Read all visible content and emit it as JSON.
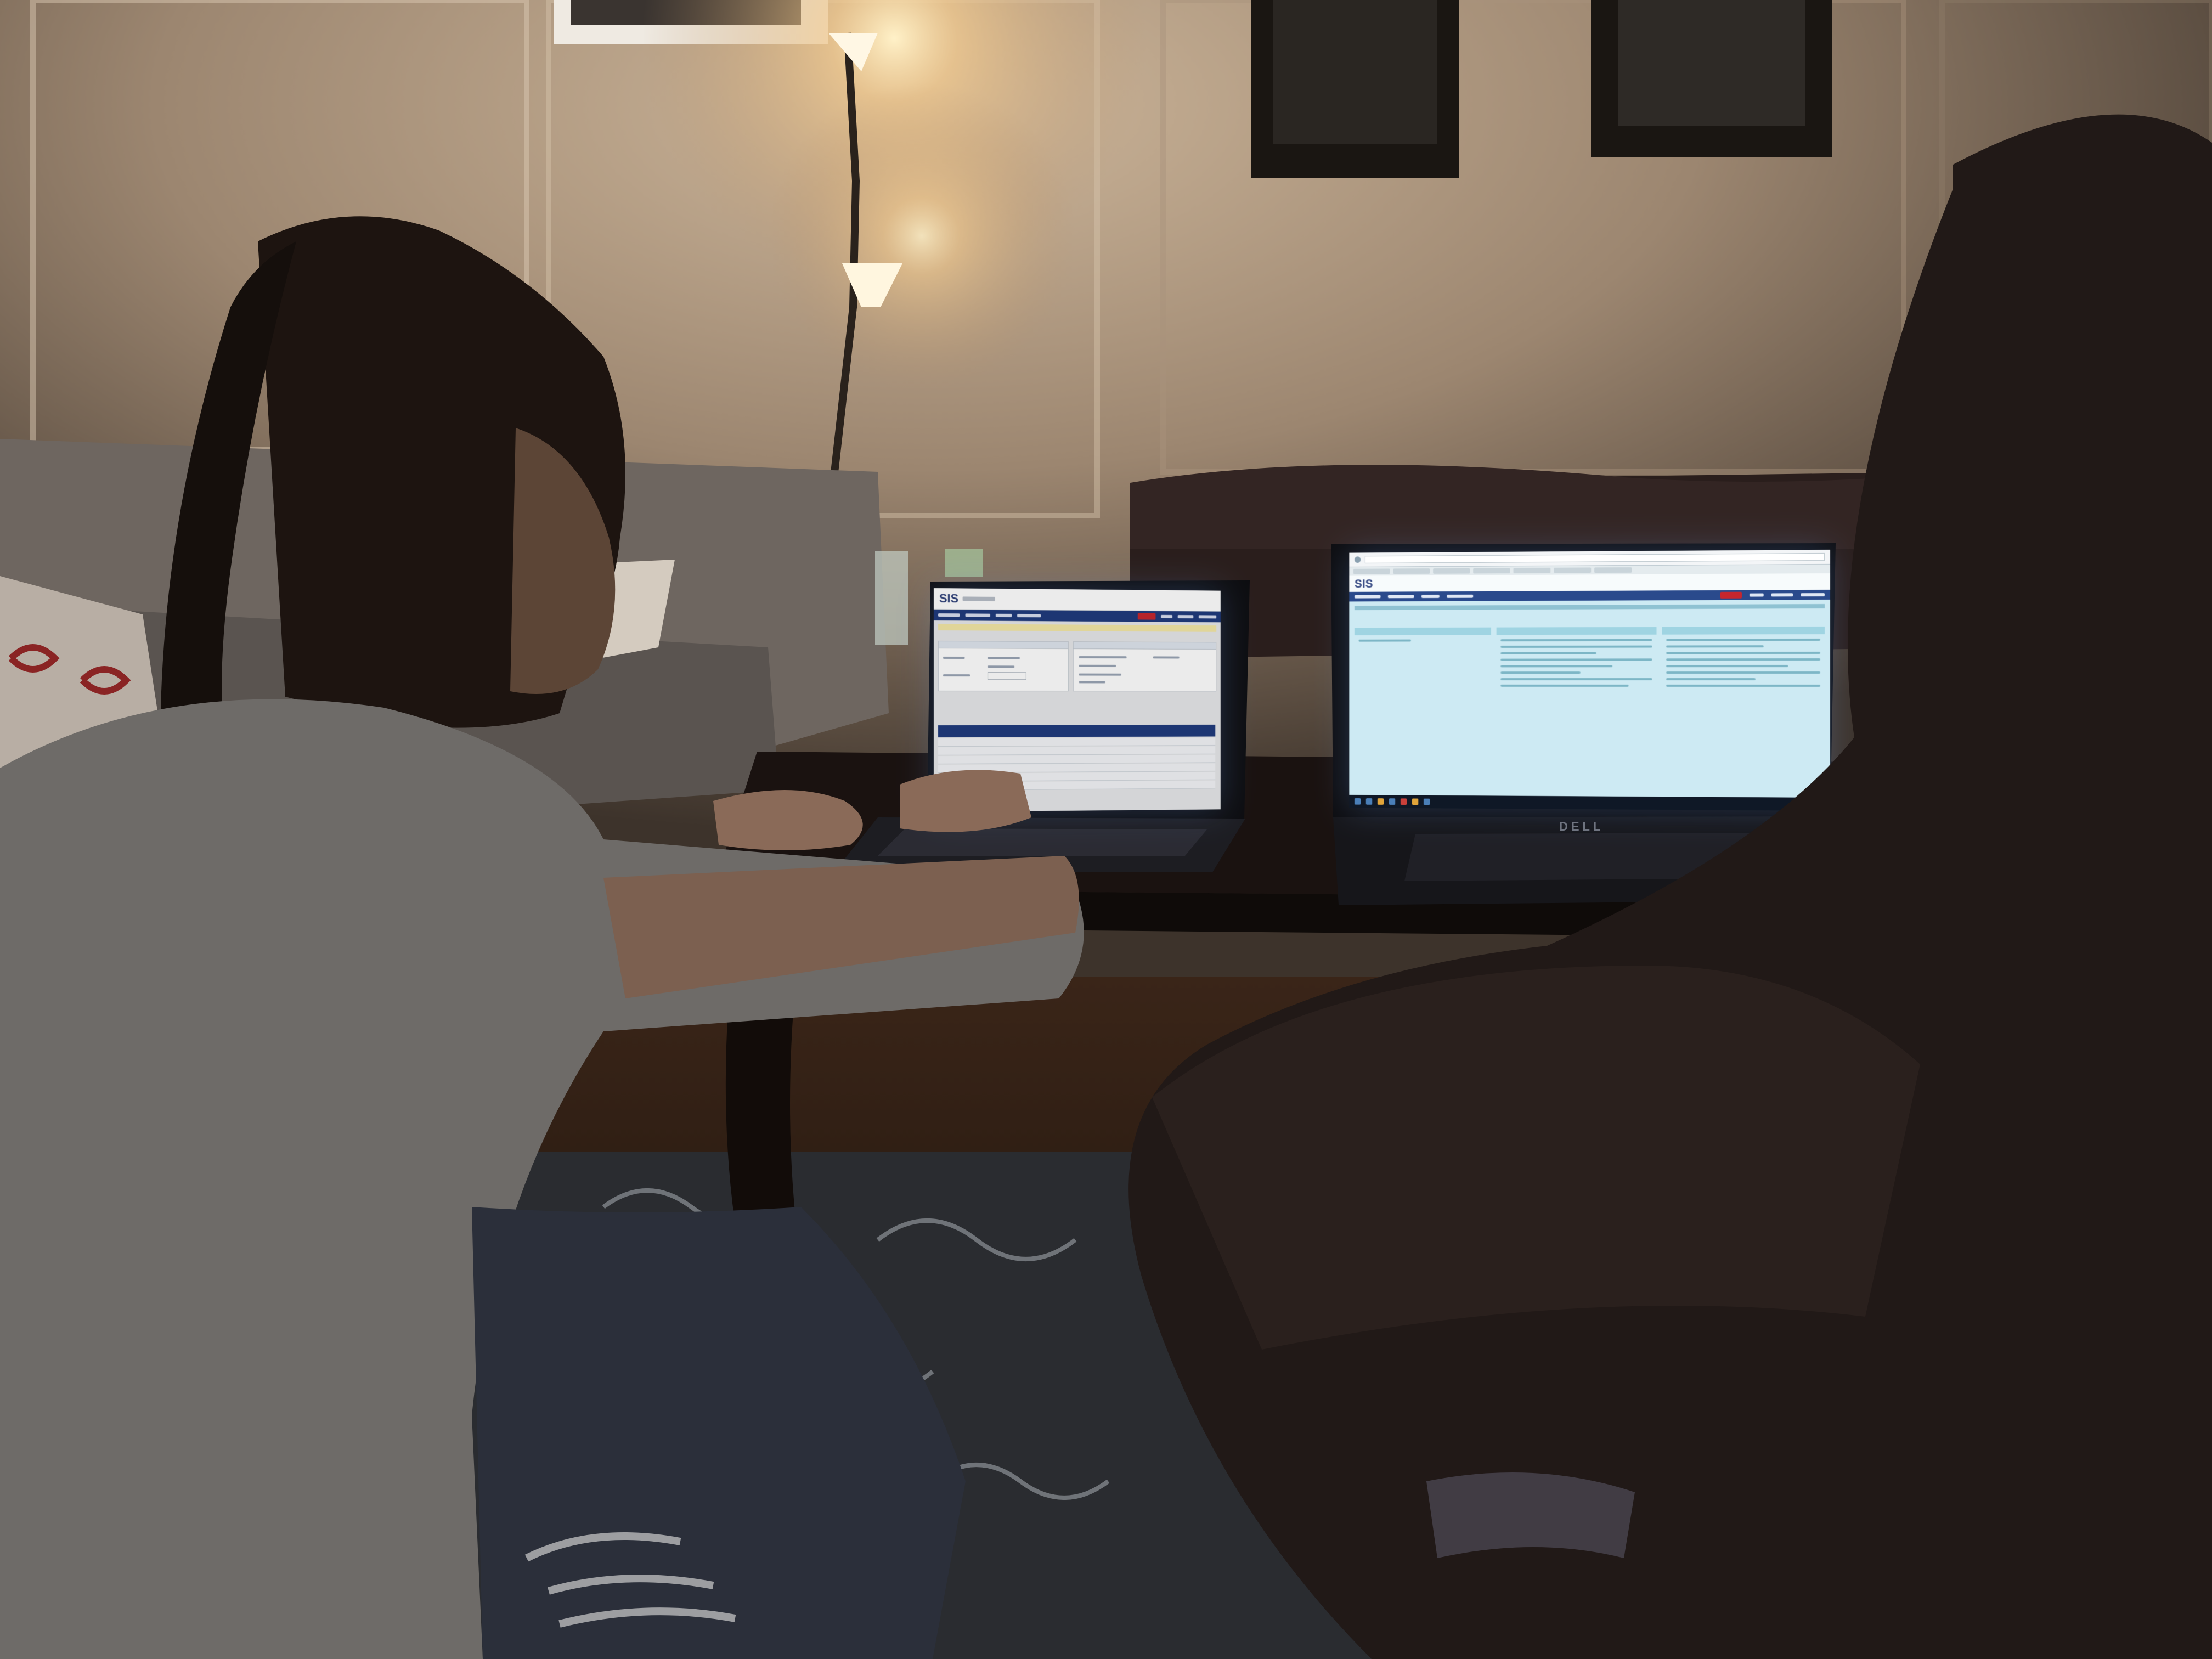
{
  "left_screen": {
    "logo": "SIS"
  },
  "right_screen": {
    "logo": "SIS"
  },
  "laptop_brand": "DELL"
}
